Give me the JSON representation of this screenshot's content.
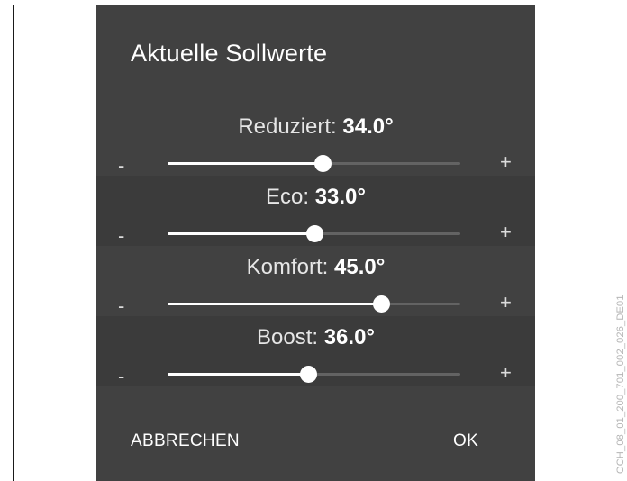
{
  "dialog": {
    "title": "Aktuelle Sollwerte",
    "rows": [
      {
        "name": "Reduziert:",
        "value": "34.0°",
        "level": 0.53
      },
      {
        "name": "Eco:",
        "value": "33.0°",
        "level": 0.5
      },
      {
        "name": "Komfort:",
        "value": "45.0°",
        "level": 0.73
      },
      {
        "name": "Boost:",
        "value": "36.0°",
        "level": 0.48
      }
    ],
    "minus_symbol": "-",
    "plus_symbol": "+",
    "cancel_label": "ABBRECHEN",
    "ok_label": "OK"
  },
  "figure_code": "OCH_08_01_200_701_002_026_DE01",
  "colors": {
    "dialog_background": "#414141",
    "row_alt_background": "#3b3b3b",
    "slider_active": "#ffffff",
    "slider_inactive": "#636363"
  }
}
